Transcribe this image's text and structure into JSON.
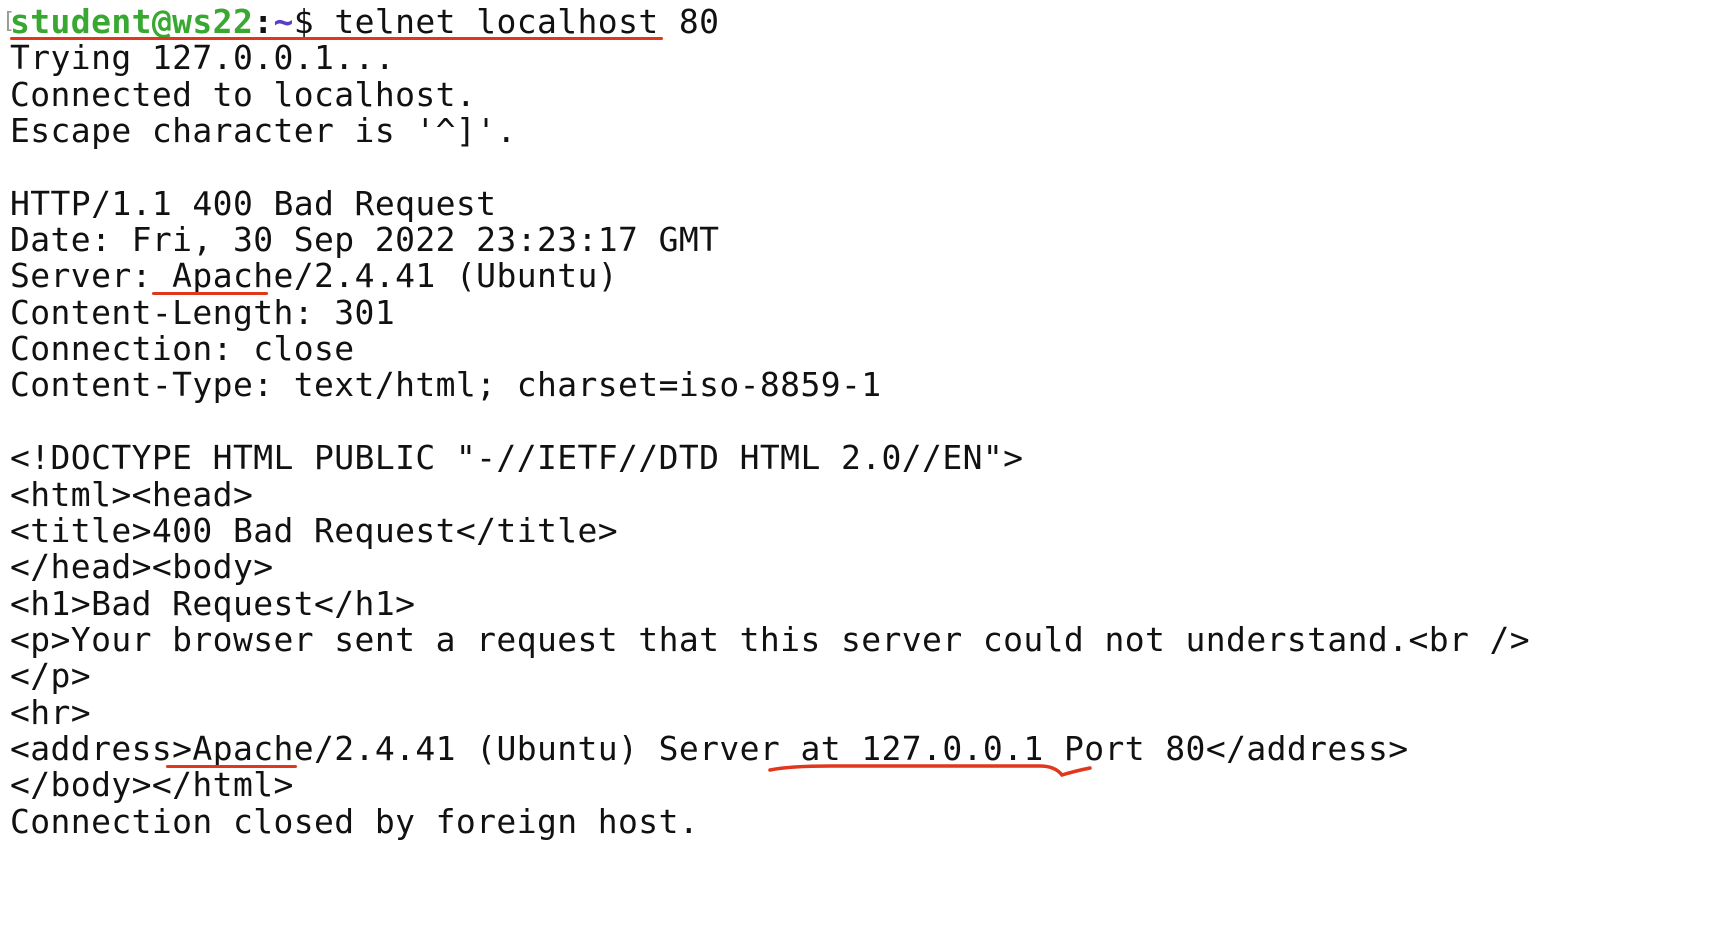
{
  "prompt": {
    "bracket": "[",
    "user_host": "student@ws22",
    "colon": ":",
    "cwd": "~",
    "symbol": "$ ",
    "command": "telnet localhost 80"
  },
  "lines": {
    "l01": "Trying 127.0.0.1...",
    "l02": "Connected to localhost.",
    "l03": "Escape character is '^]'.",
    "l05": "HTTP/1.1 400 Bad Request",
    "l06": "Date: Fri, 30 Sep 2022 23:23:17 GMT",
    "l07_prefix": "Server: ",
    "l07_apache": "Apache",
    "l07_rest": "/2.4.41 (Ubuntu)",
    "l08": "Content-Length: 301",
    "l09": "Connection: close",
    "l10": "Content-Type: text/html; charset=iso-8859-1",
    "l12": "<!DOCTYPE HTML PUBLIC \"-//IETF//DTD HTML 2.0//EN\">",
    "l13": "<html><head>",
    "l14": "<title>400 Bad Request</title>",
    "l15": "</head><body>",
    "l16": "<h1>Bad Request</h1>",
    "l17": "<p>Your browser sent a request that this server could not understand.<br />",
    "l18": "</p>",
    "l19": "<hr>",
    "l20_prefix": "<address>",
    "l20_apache": "Apache/",
    "l20_mid": "2.4.41 (Ubuntu) Server at ",
    "l20_host": "127.0.0.1 Port 80",
    "l20_suffix": "</address>",
    "l21": "</body></html>",
    "l22": "Connection closed by foreign host."
  },
  "colors": {
    "prompt_user": "#38a832",
    "prompt_dir": "#5a3ec8",
    "annotation": "#e0371d",
    "text": "#111111",
    "background": "#ffffff"
  }
}
